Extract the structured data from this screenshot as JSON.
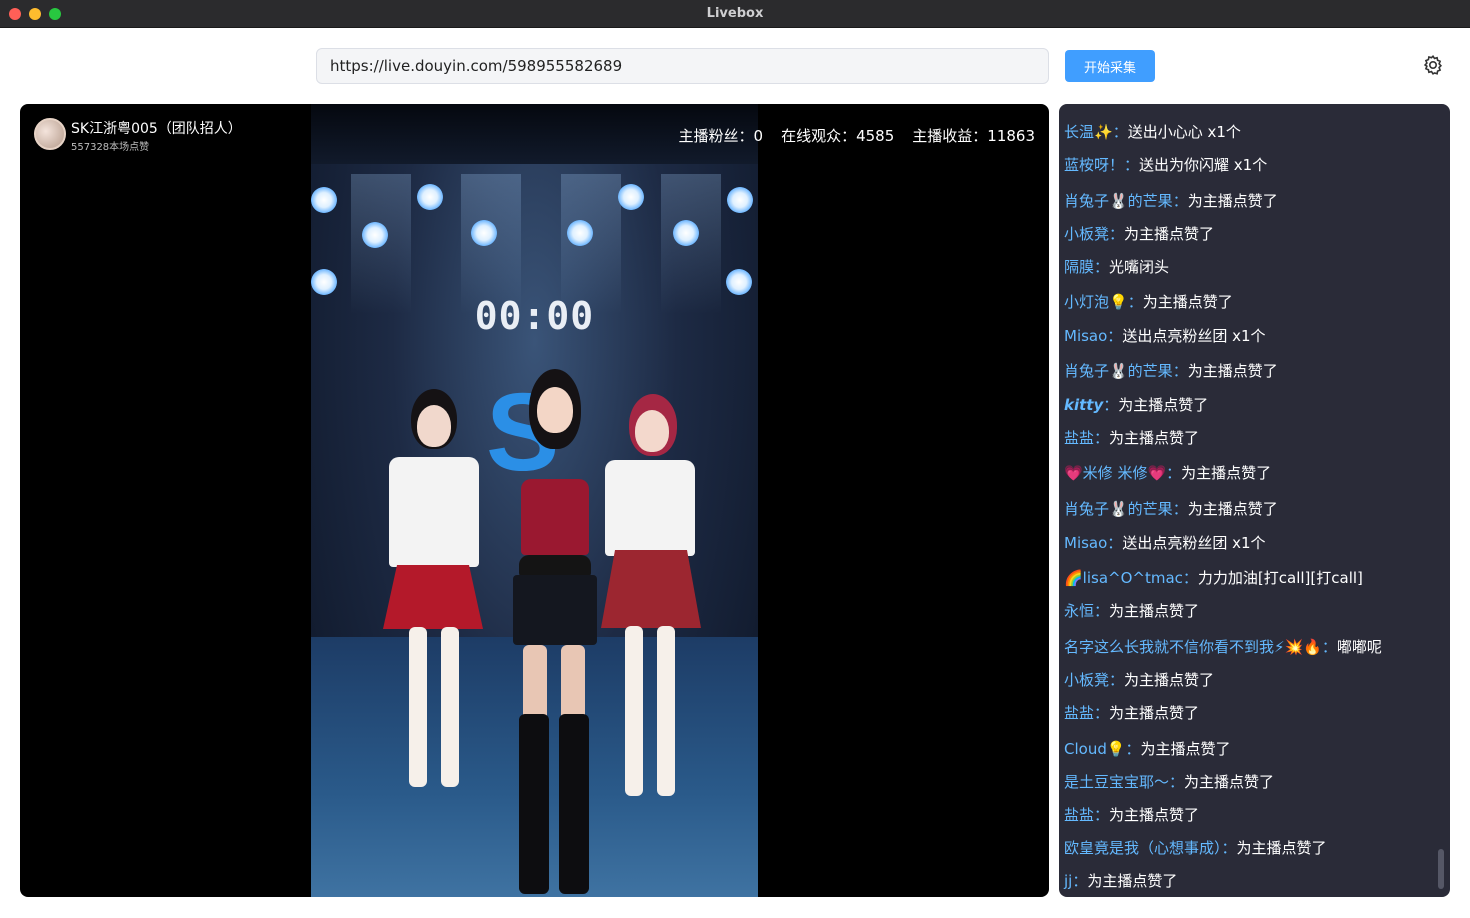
{
  "window": {
    "title": "Livebox"
  },
  "toolbar": {
    "url_value": "https://live.douyin.com/598955582689",
    "start_label": "开始采集",
    "settings_icon": "gear-icon"
  },
  "player": {
    "host_name": "SK江浙粤005（团队招人）",
    "host_likes": "557328本场点赞",
    "stats": {
      "fans": "主播粉丝：0",
      "viewers": "在线观众：4585",
      "income": "主播收益：11863"
    },
    "video_clock": "00:00"
  },
  "chat": [
    {
      "user": "长温✨",
      "text": "送出小心心 x1个"
    },
    {
      "user": "蓝桉呀！",
      "text": "送出为你闪耀 x1个"
    },
    {
      "user": "肖兔子🐰的芒果",
      "text": "为主播点赞了"
    },
    {
      "user": "小板凳",
      "text": "为主播点赞了"
    },
    {
      "user": "隔膜",
      "text": "光嘴闭头"
    },
    {
      "user": "小灯泡💡",
      "text": "为主播点赞了"
    },
    {
      "user": "Misao",
      "text": "送出点亮粉丝团 x1个"
    },
    {
      "user": "肖兔子🐰的芒果",
      "text": "为主播点赞了"
    },
    {
      "user": "kitty",
      "text": "为主播点赞了"
    },
    {
      "user": "盐盐",
      "text": "为主播点赞了"
    },
    {
      "user": "💗米修 米修💗",
      "text": "为主播点赞了"
    },
    {
      "user": "肖兔子🐰的芒果",
      "text": "为主播点赞了"
    },
    {
      "user": "Misao",
      "text": "送出点亮粉丝团 x1个"
    },
    {
      "user": "🌈lisa^O^tmac",
      "text": "力力加油[打call][打call]"
    },
    {
      "user": "永恒",
      "text": "为主播点赞了"
    },
    {
      "user": "名字这么长我就不信你看不到我⚡💥🔥",
      "text": "嘟嘟呢"
    },
    {
      "user": "小板凳",
      "text": "为主播点赞了"
    },
    {
      "user": "盐盐",
      "text": "为主播点赞了"
    },
    {
      "user": "Cloud💡",
      "text": "为主播点赞了"
    },
    {
      "user": "是土豆宝宝耶～",
      "text": "为主播点赞了"
    },
    {
      "user": "盐盐",
      "text": "为主播点赞了"
    },
    {
      "user": "欧皇竟是我（心想事成）",
      "text": "为主播点赞了"
    },
    {
      "user": "jj",
      "text": "为主播点赞了"
    }
  ],
  "chat_separator": "：",
  "colors": {
    "accent": "#409eff",
    "chat_username": "#64b9ff",
    "chat_bg": "#2a2b38"
  }
}
